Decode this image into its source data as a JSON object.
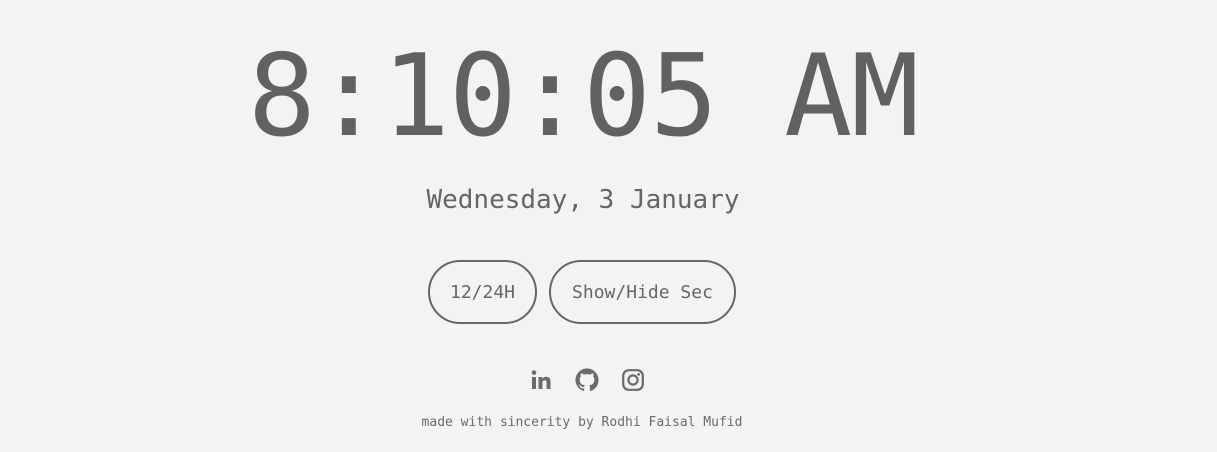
{
  "clock": {
    "time": "8:10:05 AM"
  },
  "date": {
    "text": "Wednesday, 3 January"
  },
  "controls": {
    "format_toggle_label": "12/24H",
    "seconds_toggle_label": "Show/Hide Sec"
  },
  "socials": [
    {
      "name": "linkedin",
      "icon": "linkedin-icon"
    },
    {
      "name": "github",
      "icon": "github-icon"
    },
    {
      "name": "instagram",
      "icon": "instagram-icon"
    }
  ],
  "footer": {
    "text": "made with sincerity by Rodhi Faisal Mufid"
  },
  "colors": {
    "background": "#f3f3f3",
    "foreground": "#636363"
  }
}
